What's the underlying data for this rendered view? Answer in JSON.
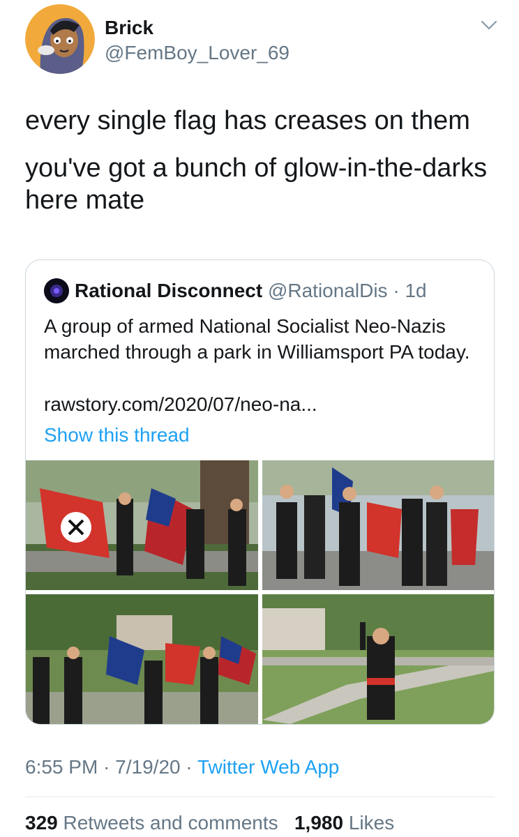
{
  "author": {
    "name": "Brick",
    "handle": "@FemBoy_Lover_69"
  },
  "tweet": {
    "lines": [
      "every single flag has creases on them",
      "you've got a bunch of glow-in-the-darks here mate"
    ]
  },
  "quoted": {
    "name": "Rational Disconnect",
    "handle": "@RationalDis",
    "separator": "·",
    "age": "1d",
    "text": "A group of armed National Socialist Neo-Nazis marched through a park in Williamsport PA today.",
    "link": "rawstory.com/2020/07/neo-na...",
    "thread_label": "Show this thread"
  },
  "meta": {
    "time": "6:55 PM",
    "date": "7/19/20",
    "separator": "·",
    "source": "Twitter Web App"
  },
  "stats": {
    "retweets_count": "329",
    "retweets_label": "Retweets and comments",
    "likes_count": "1,980",
    "likes_label": "Likes"
  },
  "icons": {
    "menu": "chevron-down-icon",
    "author_avatar": "avatar",
    "quoted_avatar": "avatar"
  },
  "colors": {
    "link_blue": "#1da1f2",
    "secondary_text": "#657786",
    "border": "#ccd6dd"
  }
}
